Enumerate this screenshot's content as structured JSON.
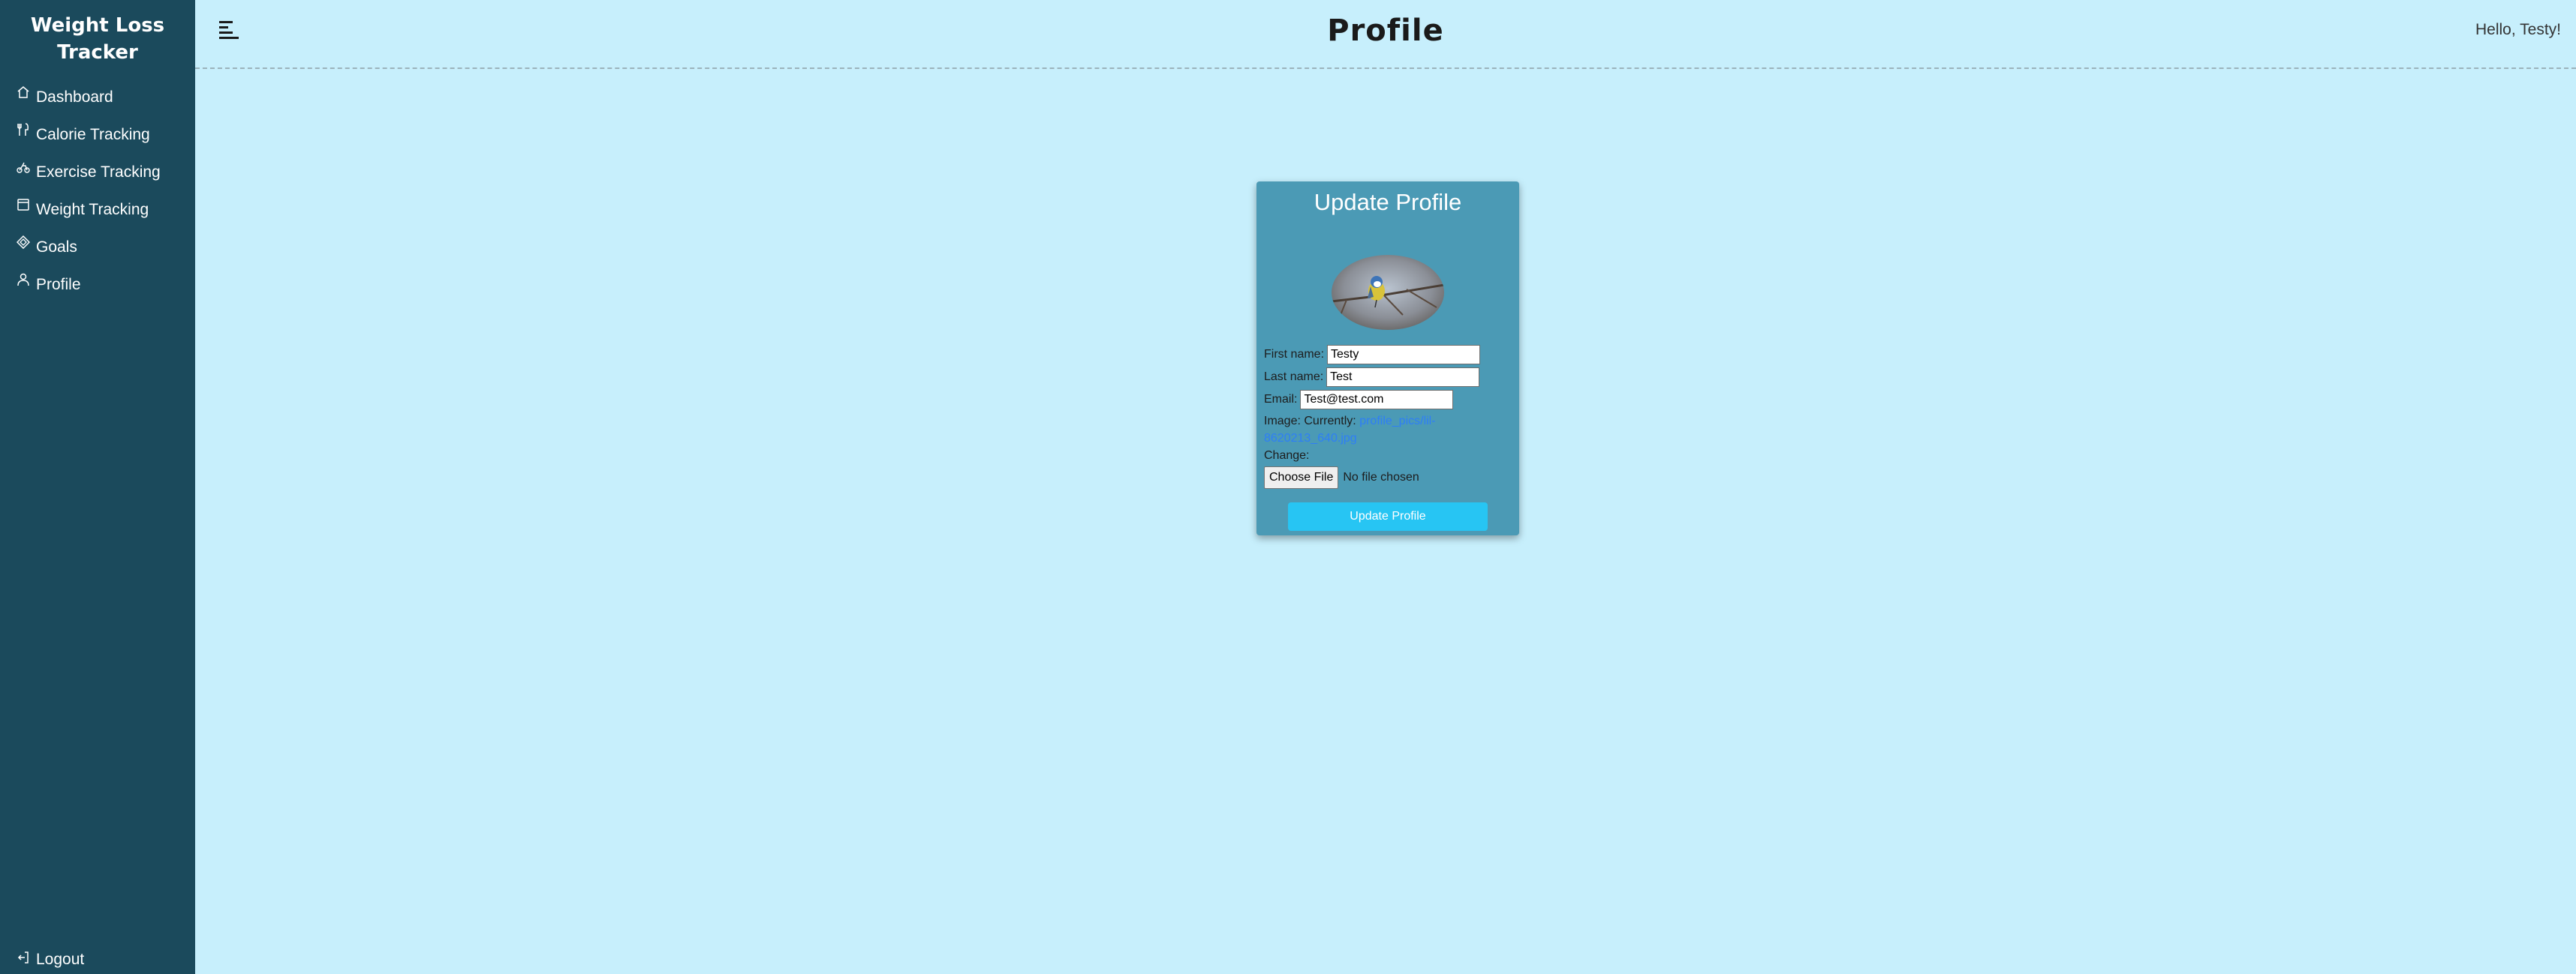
{
  "app": {
    "brand_line1": "Weight Loss",
    "brand_line2": "Tracker"
  },
  "sidebar": {
    "items": [
      {
        "label": "Dashboard",
        "icon": "home-icon"
      },
      {
        "label": "Calorie Tracking",
        "icon": "utensils-icon"
      },
      {
        "label": "Exercise Tracking",
        "icon": "bicycle-icon"
      },
      {
        "label": "Weight Tracking",
        "icon": "scale-icon"
      },
      {
        "label": "Goals",
        "icon": "target-icon"
      },
      {
        "label": "Profile",
        "icon": "user-icon"
      }
    ],
    "logout_label": "Logout",
    "logout_icon": "logout-icon"
  },
  "header": {
    "title": "Profile",
    "greeting": "Hello, Testy!",
    "menu_icon": "hamburger-icon"
  },
  "form": {
    "title": "Update Profile",
    "first_name_label": "First name:",
    "first_name_value": "Testy",
    "last_name_label": "Last name:",
    "last_name_value": "Test",
    "email_label": "Email:",
    "email_value": "Test@test.com",
    "image_label": "Image:",
    "currently_label": "Currently:",
    "current_file": "profile_pics/lil-8620213_640.jpg",
    "change_label": "Change:",
    "file_button_label": "Choose File",
    "file_status": "No file chosen",
    "submit_label": "Update Profile"
  },
  "colors": {
    "sidebar_bg": "#1b4a5c",
    "page_bg": "#c7effc",
    "card_bg": "#4b9ab5",
    "button_bg": "#27c5f3",
    "link": "#2e7ef7"
  }
}
